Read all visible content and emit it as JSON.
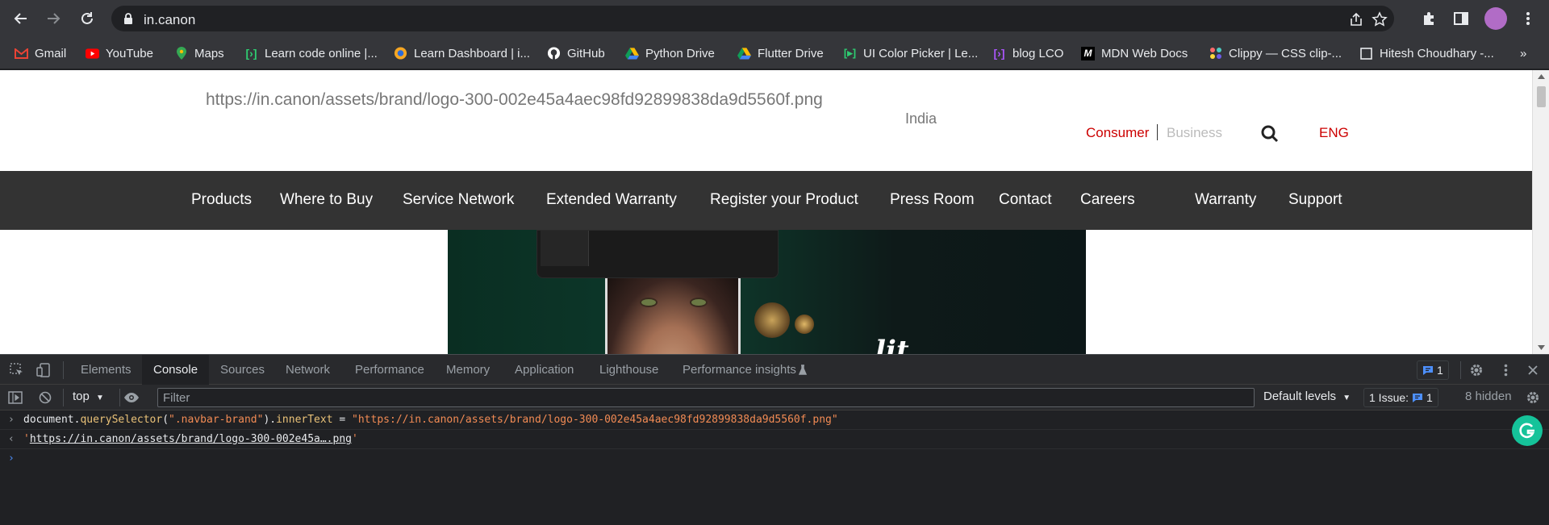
{
  "browser": {
    "url": "in.canon",
    "bookmarks": [
      {
        "label": "Gmail",
        "icon": "gmail-icon",
        "color": "#ea4335"
      },
      {
        "label": "YouTube",
        "icon": "youtube-icon",
        "color": "#ff0000"
      },
      {
        "label": "Maps",
        "icon": "maps-icon",
        "color": "#34a853"
      },
      {
        "label": "Learn code online |...",
        "icon": "code-icon",
        "color": "#2ecc71"
      },
      {
        "label": "Learn Dashboard | i...",
        "icon": "lco-icon",
        "color": "#f5a623"
      },
      {
        "label": "GitHub",
        "icon": "github-icon",
        "color": "#ffffff"
      },
      {
        "label": "Python Drive",
        "icon": "drive-icon",
        "color": "#fbbc04"
      },
      {
        "label": "Flutter Drive",
        "icon": "drive-icon",
        "color": "#fbbc04"
      },
      {
        "label": "UI Color Picker | Le...",
        "icon": "play-icon",
        "color": "#2ecc71"
      },
      {
        "label": "blog LCO",
        "icon": "code-icon",
        "color": "#a855f7"
      },
      {
        "label": "MDN Web Docs",
        "icon": "mdn-icon",
        "color": "#ffffff"
      },
      {
        "label": "Clippy — CSS clip-...",
        "icon": "clippy-icon",
        "color": "#ff6b6b"
      },
      {
        "label": "Hitesh Choudhary -...",
        "icon": "page-icon",
        "color": "#ffffff"
      }
    ],
    "overflow": "»"
  },
  "site": {
    "brand_text": "https://in.canon/assets/brand/logo-300-002e45a4aec98fd92899838da9d5560f.png",
    "country": "India",
    "consumer": "Consumer",
    "business": "Business",
    "language": "ENG",
    "nav": [
      "Products",
      "Where to Buy",
      "Service Network",
      "Extended Warranty",
      "Register your Product",
      "Press Room",
      "Contact",
      "Careers",
      "Warranty",
      "Support"
    ],
    "hero_script": "lit",
    "accent": "#cc0000"
  },
  "devtools": {
    "tabs": [
      "Elements",
      "Console",
      "Sources",
      "Network",
      "Performance",
      "Memory",
      "Application",
      "Lighthouse",
      "Performance insights"
    ],
    "active_tab": "Console",
    "messages_count": "1",
    "context": "top",
    "filter_placeholder": "Filter",
    "levels": "Default levels",
    "issues_label": "1 Issue:",
    "issues_count": "1",
    "hidden": "8 hidden",
    "command": {
      "obj": "document",
      "method": "querySelector",
      "arg": "\".navbar-brand\"",
      "prop": "innerText",
      "op": " = ",
      "value": "\"https://in.canon/assets/brand/logo-300-002e45a4aec98fd92899838da9d5560f.png\""
    },
    "result": "https://in.canon/assets/brand/logo-300-002e45a….png"
  }
}
